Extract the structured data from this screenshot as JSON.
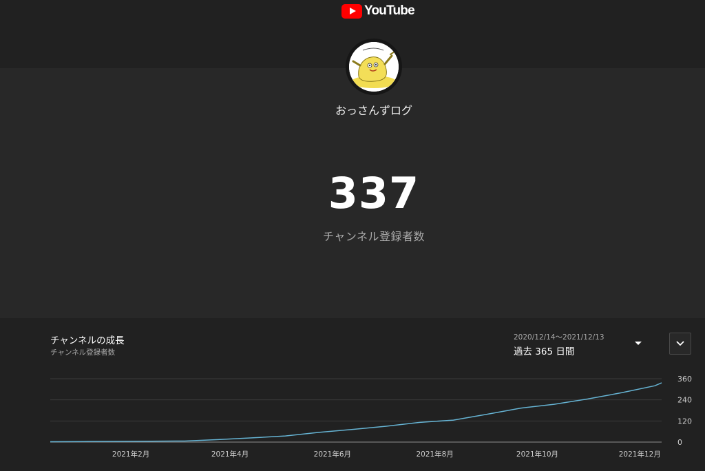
{
  "header": {
    "logo_text": "YouTube",
    "logo_color": "#ff0000"
  },
  "channel": {
    "name": "おっさんずログ",
    "subscriber_count": "337",
    "subscriber_label": "チャンネル登録者数"
  },
  "growth_panel": {
    "title": "チャンネルの成長",
    "subtitle": "チャンネル登録者数",
    "date_range": "2020/12/14〜2021/12/13",
    "period_label": "過去 365 日間",
    "expand_icon": "chevron-down-icon"
  },
  "chart_data": {
    "type": "line",
    "line_color": "#66b4d4",
    "grid": true,
    "y_ticks": [
      "0",
      "120",
      "240",
      "360"
    ],
    "ylim": [
      0,
      360
    ],
    "x_ticks": [
      {
        "label": "2021年2月",
        "day": 48
      },
      {
        "label": "2021年4月",
        "day": 107
      },
      {
        "label": "2021年6月",
        "day": 168
      },
      {
        "label": "2021年8月",
        "day": 229
      },
      {
        "label": "2021年10月",
        "day": 290
      },
      {
        "label": "2021年12月",
        "day": 351
      }
    ],
    "series": [
      {
        "x": [
          0,
          20,
          40,
          60,
          80,
          100,
          120,
          140,
          160,
          180,
          200,
          220,
          240,
          260,
          280,
          300,
          320,
          340,
          360,
          364
        ],
        "values": [
          2,
          3,
          4,
          5,
          6,
          14,
          24,
          35,
          55,
          72,
          90,
          112,
          125,
          158,
          193,
          215,
          245,
          280,
          320,
          337
        ]
      }
    ]
  }
}
